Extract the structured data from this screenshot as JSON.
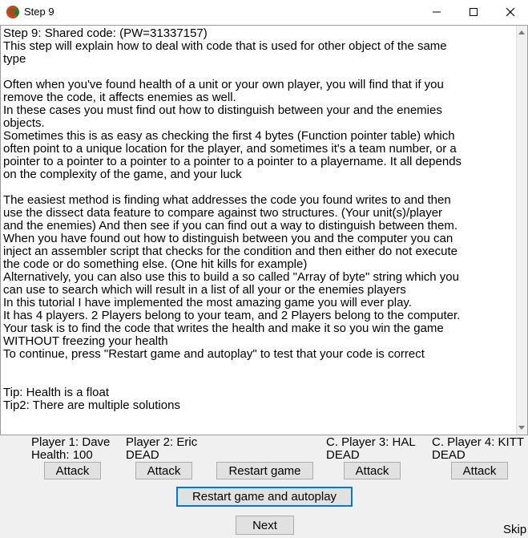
{
  "window": {
    "title": "Step 9",
    "icon": "cheat-engine-icon",
    "controls": [
      "minimize-icon",
      "maximize-icon",
      "close-icon"
    ]
  },
  "memo": {
    "lines": [
      "Step 9: Shared code: (PW=31337157)",
      "This step will explain how to deal with code that is used for other object of the same",
      "type",
      "",
      "Often when you've found health of a unit or your own player, you will find that if you",
      "remove the code, it affects enemies as well.",
      "In these cases you must find out how to distinguish between your and the enemies",
      "objects.",
      "Sometimes this is as easy as checking the first 4 bytes (Function pointer table) which",
      "often point to a unique location for the player, and sometimes it's a team number, or a",
      "pointer to a pointer to a pointer to a pointer to a pointer to a playername. It all depends",
      "on the complexity of the game, and your luck",
      "",
      "The easiest method is finding what addresses the code you found writes to and then",
      "use the dissect data feature to compare against two structures. (Your unit(s)/player",
      "and the enemies) And then see if you can find out a way to distinguish between them.",
      "When you have found out how to distinguish between you and the computer you can",
      "inject an assembler script that checks for the condition and then either do not execute",
      "the code or do something else. (One hit kills for example)",
      "Alternatively, you can also use this to build a so called \"Array of byte\" string which you",
      "can use to search which will result in a list of all your or the enemies players",
      "In this tutorial I have implemented the most amazing game you will ever play.",
      "It has 4 players. 2 Players belong to your team, and 2 Players belong to the computer.",
      "Your task is to find the code that writes the health and make it so you win the game",
      "WITHOUT freezing your health",
      "To continue, press \"Restart game and autoplay\" to test that your code is correct",
      "",
      "",
      "Tip: Health is a float",
      "Tip2: There are multiple solutions"
    ]
  },
  "players": [
    {
      "name": "Player 1: Dave",
      "status": "Health: 100",
      "attack_label": "Attack"
    },
    {
      "name": "Player 2: Eric",
      "status": "DEAD",
      "attack_label": "Attack"
    },
    {
      "name": "C. Player 3: HAL",
      "status": "DEAD",
      "attack_label": "Attack"
    },
    {
      "name": "C. Player 4: KITT",
      "status": "DEAD",
      "attack_label": "Attack"
    }
  ],
  "buttons": {
    "restart": "Restart game",
    "restart_autoplay": "Restart game and autoplay",
    "next": "Next",
    "skip": "Skip"
  }
}
